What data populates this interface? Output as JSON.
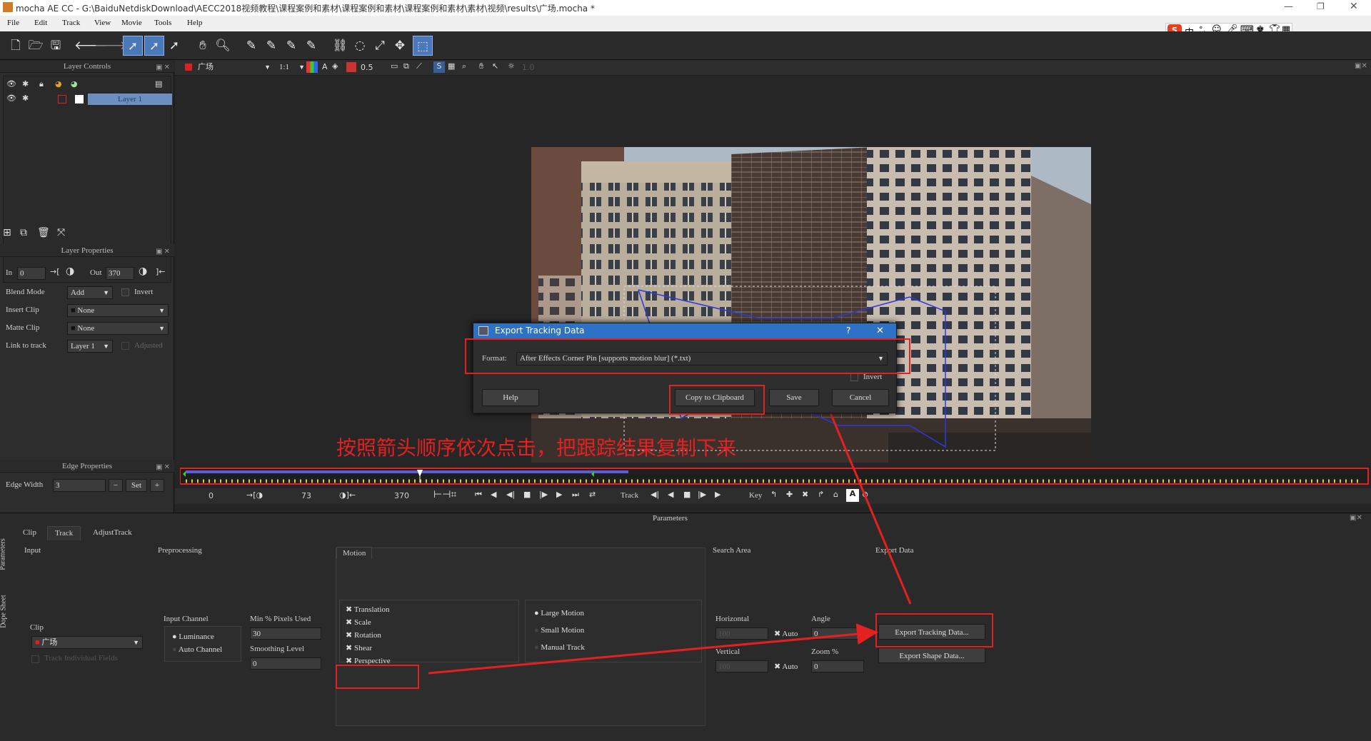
{
  "window": {
    "title": "mocha AE CC - G:\\BaiduNetdiskDownload\\AECC2018视频教程\\课程案例和素材\\课程案例和素材\\课程案例和素材\\素材\\视频\\results\\广场.mocha *"
  },
  "menu": [
    "File",
    "Edit",
    "Track",
    "View",
    "Movie",
    "Tools",
    "Help"
  ],
  "ime": {
    "label": "中"
  },
  "layer_controls": {
    "title": "Layer Controls",
    "layer_name": "Layer 1"
  },
  "layer_properties": {
    "title": "Layer Properties",
    "in_label": "In",
    "in_value": "0",
    "out_label": "Out",
    "out_value": "370",
    "blend_mode_label": "Blend Mode",
    "blend_mode_value": "Add",
    "invert_label": "Invert",
    "insert_clip_label": "Insert Clip",
    "insert_clip_value": "None",
    "matte_clip_label": "Matte Clip",
    "matte_clip_value": "None",
    "link_label": "Link to track",
    "link_value": "Layer 1",
    "adjusted_label": "Adjusted"
  },
  "edge_properties": {
    "title": "Edge Properties",
    "edge_width_label": "Edge Width",
    "edge_width_value": "3",
    "set_label": "Set"
  },
  "viewer": {
    "clip_name": "广场",
    "zoom": "1:1",
    "opacity": "0.5",
    "alt_value": "1.0"
  },
  "timeline": {
    "start": "0",
    "current": "73",
    "end": "370",
    "track_label": "Track",
    "key_label": "Key"
  },
  "params": {
    "title": "Parameters",
    "tabs": [
      "Clip",
      "Track",
      "AdjustTrack"
    ],
    "side_tabs": [
      "Parameters",
      "Dope Sheet"
    ],
    "input": {
      "title": "Input",
      "clip_label": "Clip",
      "clip_value": "广场",
      "track_fields": "Track Individual Fields"
    },
    "preprocessing": {
      "title": "Preprocessing",
      "input_channel": "Input Channel",
      "luminance": "Luminance",
      "auto_channel": "Auto Channel",
      "min_pixels_label": "Min % Pixels Used",
      "min_pixels_value": "30",
      "smoothing_label": "Smoothing Level",
      "smoothing_value": "0"
    },
    "motion": {
      "title": "Motion",
      "items": [
        "Translation",
        "Scale",
        "Rotation",
        "Shear",
        "Perspective"
      ],
      "large_motion": "Large Motion",
      "small_motion": "Small Motion",
      "manual_track": "Manual Track"
    },
    "search_area": {
      "title": "Search Area",
      "horizontal": "Horizontal",
      "vertical": "Vertical",
      "h_value": "100",
      "v_value": "100",
      "auto": "Auto",
      "angle": "Angle",
      "angle_value": "0",
      "zoom": "Zoom %",
      "zoom_value": "0"
    },
    "export_data": {
      "title": "Export Data",
      "tracking_btn": "Export Tracking Data...",
      "shape_btn": "Export Shape Data..."
    }
  },
  "dialog": {
    "title": "Export Tracking Data",
    "help_q": "?",
    "format_label": "Format:",
    "format_value": "After Effects Corner Pin [supports motion blur] (*.txt)",
    "invert_label": "Invert",
    "help_btn": "Help",
    "copy_btn": "Copy to Clipboard",
    "save_btn": "Save",
    "cancel_btn": "Cancel"
  },
  "annotation": {
    "text": "按照箭头顺序依次点击，把跟踪结果复制下来",
    "color": "#e52020"
  }
}
